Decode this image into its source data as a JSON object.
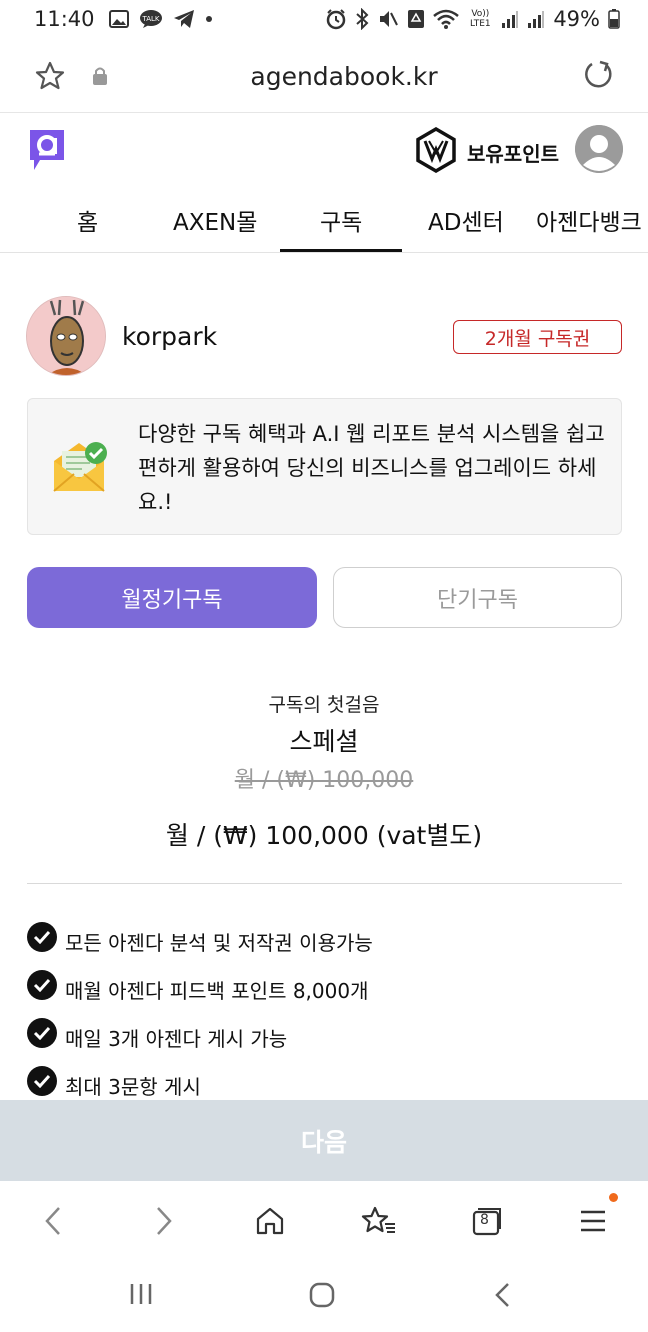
{
  "status_bar": {
    "time": "11:40",
    "network_label": "Vo)) LTE1",
    "battery": "49%"
  },
  "browser": {
    "url": "agendabook.kr",
    "tab_count": "8"
  },
  "header": {
    "points_label": "보유포인트"
  },
  "nav": {
    "tabs": [
      "홈",
      "AXEN몰",
      "구독",
      "AD센터",
      "아젠다뱅크"
    ],
    "active_index": 2
  },
  "profile": {
    "username": "korpark",
    "badge": "2개월 구독권"
  },
  "info": {
    "message": "다양한 구독 혜택과 A.I 웹 리포트 분석 시스템을 쉽고 편하게 활용하여 당신의 비즈니스를 업그레이드 하세요.!"
  },
  "segments": {
    "monthly": "월정기구독",
    "short": "단기구독"
  },
  "plan": {
    "subtitle": "구독의 첫걸음",
    "name": "스페셜",
    "old_price": "월 / (₩) 100,000",
    "price": "월 / (₩) 100,000 (vat별도)"
  },
  "features": [
    "모든 아젠다 분석 및 저작권 이용가능",
    "매월 아젠다 피드백 포인트 8,000개",
    "매일 3개 아젠다 게시 가능",
    "최대 3문항 게시"
  ],
  "next_button": "다음",
  "colors": {
    "accent": "#7c6ad8",
    "badge_red": "#c62828",
    "next_disabled": "#d6dde3",
    "notification_dot": "#f06a1c"
  }
}
